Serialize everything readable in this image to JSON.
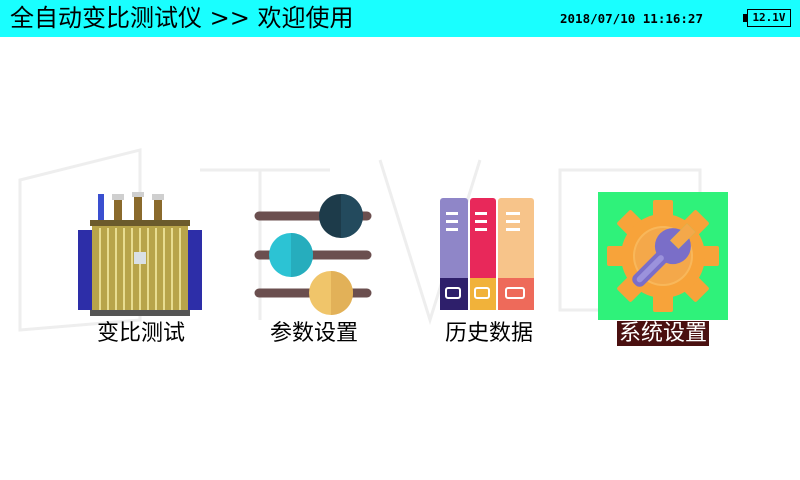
{
  "header": {
    "title": "全自动变比测试仪 >> 欢迎使用",
    "datetime": "2018/07/10 11:16:27",
    "battery": "12.1V",
    "background_color": "#19ffff"
  },
  "menu": [
    {
      "label": "变比测试",
      "icon": "transformer-icon",
      "selected": false
    },
    {
      "label": "参数设置",
      "icon": "sliders-icon",
      "selected": false
    },
    {
      "label": "历史数据",
      "icon": "binders-icon",
      "selected": false
    },
    {
      "label": "系统设置",
      "icon": "gear-wrench-icon",
      "selected": true
    }
  ],
  "colors": {
    "selected_label_bg": "#4a1010",
    "gear_tile_bg": "#2ff27a",
    "gear_orange": "#f7a33a"
  }
}
